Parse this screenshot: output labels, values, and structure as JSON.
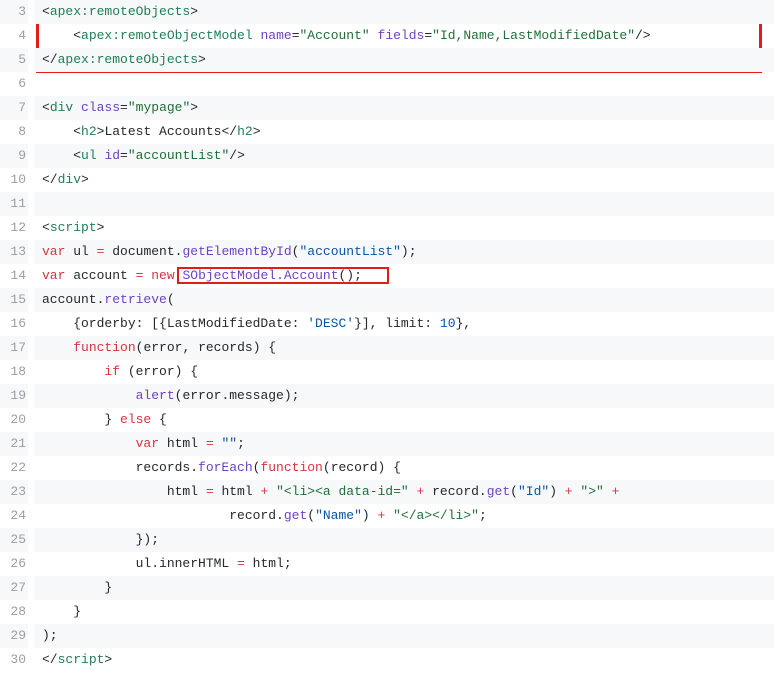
{
  "gutter": [
    "3",
    "4",
    "5",
    "6",
    "7",
    "8",
    "9",
    "10",
    "11",
    "12",
    "13",
    "14",
    "15",
    "16",
    "17",
    "18",
    "19",
    "20",
    "21",
    "22",
    "23",
    "24",
    "25",
    "26",
    "27",
    "28",
    "29",
    "30"
  ],
  "code": {
    "l3": {
      "a": "<",
      "b": "apex:remoteObjects",
      "c": ">"
    },
    "l4": {
      "a": "    <",
      "b": "apex:remoteObjectModel",
      "c": " ",
      "d": "name",
      "e": "=",
      "f": "\"Account\"",
      "g": " ",
      "h": "fields",
      "i": "=",
      "j": "\"Id,Name,LastModifiedDate\"",
      "k": "/>"
    },
    "l5": {
      "a": "</",
      "b": "apex:remoteObjects",
      "c": ">"
    },
    "l6": {
      "a": ""
    },
    "l7": {
      "a": "<",
      "b": "div",
      "c": " ",
      "d": "class",
      "e": "=",
      "f": "\"mypage\"",
      "g": ">"
    },
    "l8": {
      "a": "    <",
      "b": "h2",
      "c": ">",
      "d": "Latest Accounts",
      "e": "</",
      "f": "h2",
      "g": ">"
    },
    "l9": {
      "a": "    <",
      "b": "ul",
      "c": " ",
      "d": "id",
      "e": "=",
      "f": "\"accountList\"",
      "g": "/>"
    },
    "l10": {
      "a": "</",
      "b": "div",
      "c": ">"
    },
    "l11": {
      "a": ""
    },
    "l12": {
      "a": "<",
      "b": "script",
      "c": ">"
    },
    "l13": {
      "a": "var",
      "b": " ul ",
      "c": "=",
      "d": " document.",
      "e": "getElementById",
      "f": "(",
      "g": "\"accountList\"",
      "h": ");"
    },
    "l14": {
      "a": "var",
      "b": " account ",
      "c": "=",
      "d": " ",
      "e": "new",
      "f": " ",
      "g": "SObjectModel.Account",
      "h": "();"
    },
    "l15": {
      "a": "account.",
      "b": "retrieve",
      "c": "("
    },
    "l16": {
      "a": "    {orderby: [{LastModifiedDate: ",
      "b": "'DESC'",
      "c": "}], limit: ",
      "d": "10",
      "e": "},"
    },
    "l17": {
      "a": "    ",
      "b": "function",
      "c": "(",
      "d": "error",
      ", ": "",
      "e": ", ",
      "f": "records",
      "g": ") {"
    },
    "l18": {
      "a": "        ",
      "b": "if",
      "c": " (error) {"
    },
    "l19": {
      "a": "            ",
      "b": "alert",
      "c": "(error.message);"
    },
    "l20": {
      "a": "        } ",
      "b": "else",
      "c": " {"
    },
    "l21": {
      "a": "            ",
      "b": "var",
      "c": " html ",
      "d": "=",
      "e": " ",
      "f": "\"\"",
      "g": ";"
    },
    "l22": {
      "a": "            records.",
      "b": "forEach",
      "c": "(",
      "d": "function",
      "e": "(",
      "f": "record",
      "g": ") {"
    },
    "l23": {
      "a": "                html ",
      "b": "=",
      "c": " html ",
      "d": "+",
      "e": " ",
      "f": "\"<li><a data-id=\"",
      "g": " ",
      "h": "+",
      "i": " record.",
      "j": "get",
      "k": "(",
      "l": "\"Id\"",
      "m": ") ",
      "n": "+",
      "o": " ",
      "p": "\">\"",
      "q": " ",
      "r": "+"
    },
    "l24": {
      "a": "                        record.",
      "b": "get",
      "c": "(",
      "d": "\"Name\"",
      "e": ") ",
      "f": "+",
      "g": " ",
      "h": "\"</a></li>\"",
      "i": ";"
    },
    "l25": {
      "a": "            });"
    },
    "l26": {
      "a": "            ul.innerHTML ",
      "b": "=",
      "c": " html;"
    },
    "l27": {
      "a": "        }"
    },
    "l28": {
      "a": "    }"
    },
    "l29": {
      "a": ");"
    },
    "l30": {
      "a": "</",
      "b": "script",
      "c": ">"
    }
  }
}
